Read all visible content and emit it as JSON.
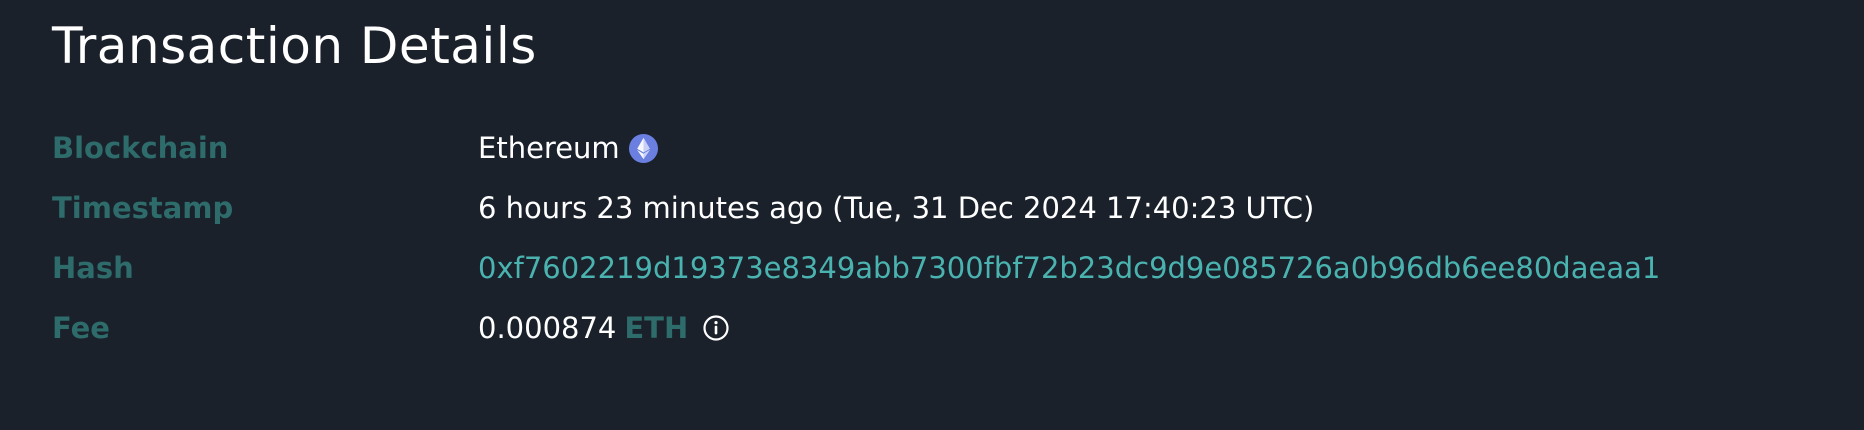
{
  "page": {
    "title": "Transaction Details"
  },
  "details": {
    "blockchain": {
      "label": "Blockchain",
      "value": "Ethereum",
      "icon": "ethereum-icon"
    },
    "timestamp": {
      "label": "Timestamp",
      "value": "6 hours 23 minutes ago (Tue, 31 Dec 2024 17:40:23 UTC)"
    },
    "hash": {
      "label": "Hash",
      "value": "0xf7602219d19373e8349abb7300fbf72b23dc9d9e085726a0b96db6ee80daeaa1"
    },
    "fee": {
      "label": "Fee",
      "amount": "0.000874",
      "unit": "ETH",
      "icon": "info-icon"
    }
  },
  "colors": {
    "background": "#1a212b",
    "label": "#2e6b6b",
    "link": "#4ab3b0",
    "text": "#ffffff",
    "eth_badge": "#6b7fe0"
  }
}
